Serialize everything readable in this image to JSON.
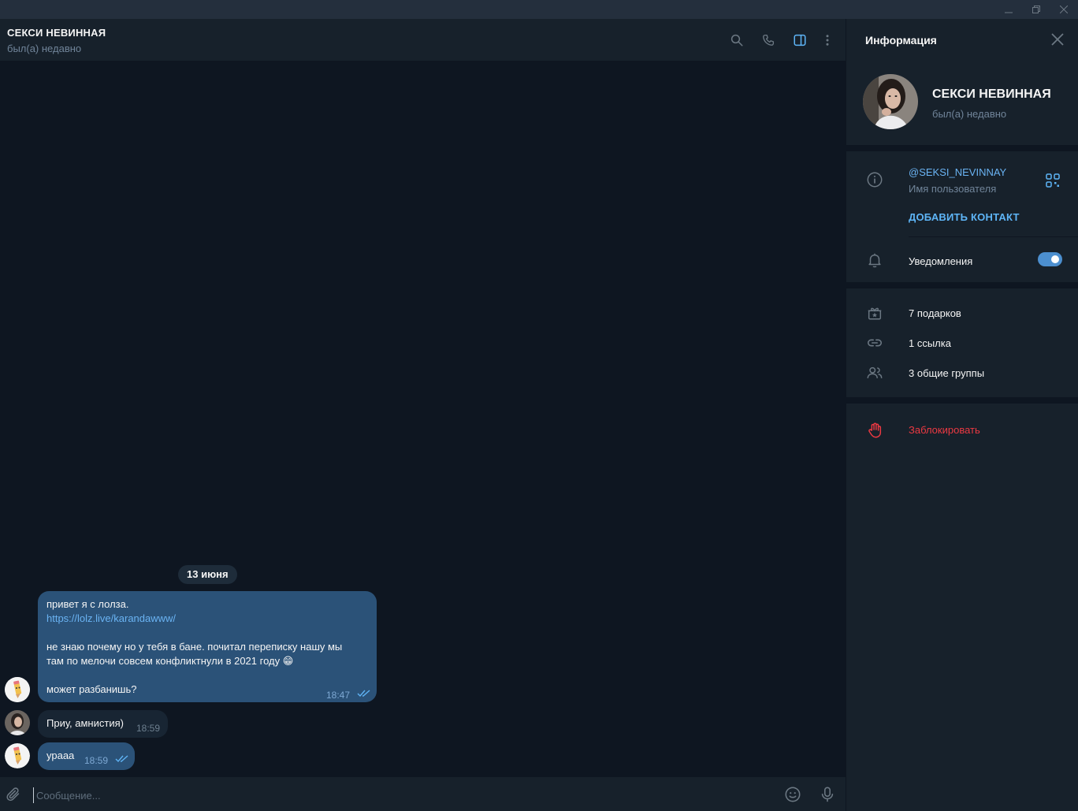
{
  "window": {
    "minimize_label": "minimize",
    "restore_label": "restore",
    "close_label": "close"
  },
  "chat": {
    "title": "СЕКСИ НЕВИННАЯ",
    "status": "был(а) недавно",
    "date_separator": "13 июня",
    "messages": [
      {
        "direction": "out",
        "lines": {
          "l1": "привет я с лолза.",
          "link": "https://lolz.live/karandawww/",
          "l3": "не знаю почему но у тебя в бане. почитал переписку нашу мы",
          "l4": "там по мелочи совсем конфликтнули в 2021 году 😁",
          "l5": "может разбанишь?"
        },
        "time": "18:47",
        "read": true
      },
      {
        "direction": "in",
        "text": "Приу, амнистия)",
        "time": "18:59"
      },
      {
        "direction": "out",
        "text": "урааа",
        "time": "18:59",
        "read": true
      }
    ]
  },
  "composer": {
    "placeholder": "Сообщение..."
  },
  "info": {
    "title": "Информация",
    "name": "СЕКСИ НЕВИННАЯ",
    "status": "был(а) недавно",
    "username": "@SEKSI_NEVINNAY",
    "username_label": "Имя пользователя",
    "add_contact": "ДОБАВИТЬ КОНТАКТ",
    "notifications_label": "Уведомления",
    "notifications_on": true,
    "gifts": "7 подарков",
    "links": "1 ссылка",
    "groups": "3 общие группы",
    "block": "Заблокировать"
  },
  "colors": {
    "background": "#0e1621",
    "panel": "#17212b",
    "outgoing_bubble": "#2b5278",
    "incoming_bubble": "#182533",
    "accent": "#5eb5f7",
    "danger": "#ec3942"
  },
  "icons": [
    "search-icon",
    "phone-icon",
    "sidebar-toggle-icon",
    "more-vertical-icon",
    "paperclip-icon",
    "emoji-icon",
    "microphone-icon",
    "close-icon",
    "info-icon",
    "qr-code-icon",
    "bell-icon",
    "gift-icon",
    "link-icon",
    "users-icon",
    "hand-icon"
  ]
}
